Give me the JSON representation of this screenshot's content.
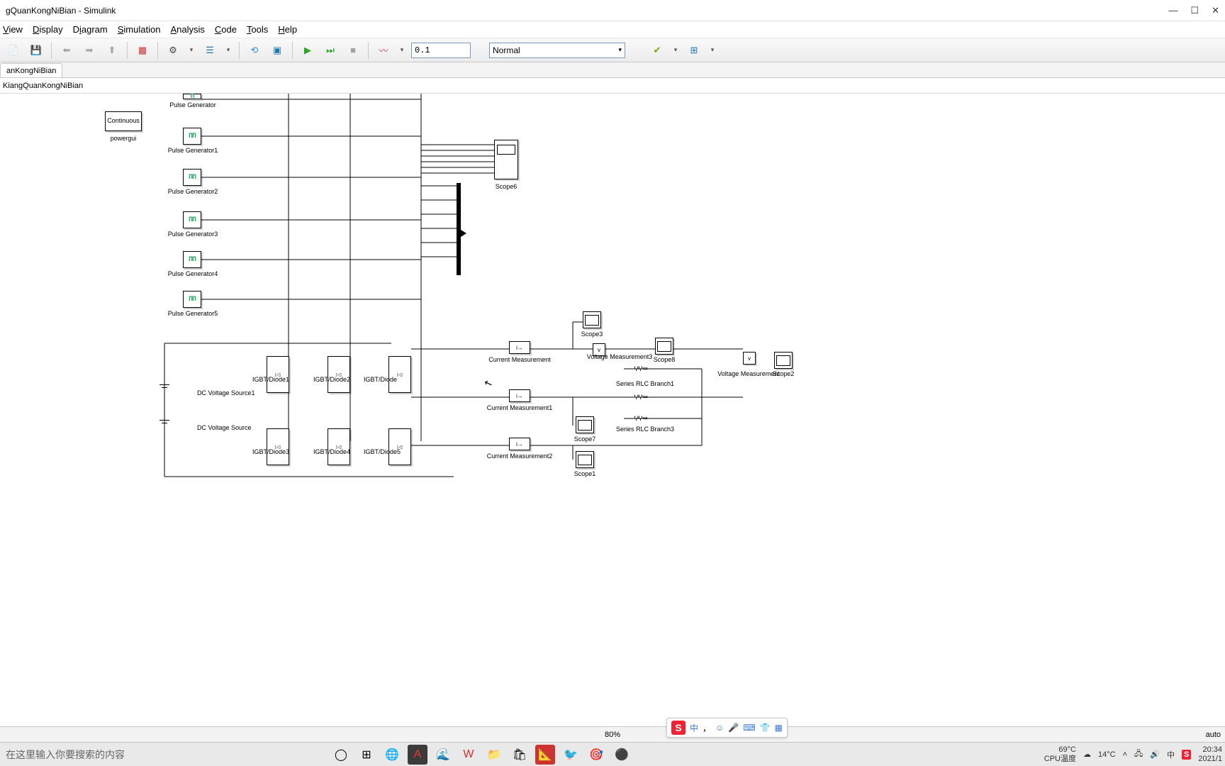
{
  "window": {
    "title": "gQuanKongNiBian - Simulink",
    "min": "—",
    "max": "☐",
    "close": "✕"
  },
  "menu": {
    "view": "View",
    "display": "Display",
    "diagram": "Diagram",
    "simulation": "Simulation",
    "analysis": "Analysis",
    "code": "Code",
    "tools": "Tools",
    "help": "Help"
  },
  "toolbar": {
    "stop_time": "0.1",
    "mode": "Normal"
  },
  "tab": {
    "name": "anKongNiBian"
  },
  "breadcrumb": {
    "path": "KiangQuanKongNiBian"
  },
  "blocks": {
    "powergui": "Continuous",
    "powergui_lbl": "powergui",
    "pg0": "Pulse\nGenerator",
    "pg1": "Pulse\nGenerator1",
    "pg2": "Pulse\nGenerator2",
    "pg3": "Pulse\nGenerator3",
    "pg4": "Pulse\nGenerator4",
    "pg5": "Pulse\nGenerator5",
    "scope6": "Scope6",
    "scope3": "Scope3",
    "scope8": "Scope8",
    "scope7": "Scope7",
    "scope1": "Scope1",
    "scope2": "Scope2",
    "dcvs1": "DC Voltage Source1",
    "dcvs": "DC Voltage Source",
    "igbt1": "IGBT/Diode1",
    "igbt2": "IGBT/Diode2",
    "igbt": "IGBT/Diode",
    "igbt3": "IGBT/Diode3",
    "igbt4": "IGBT/Diode4",
    "igbt5": "IGBT/Diode5",
    "cm": "Current Measurement",
    "cm1": "Current Measurement1",
    "cm2": "Current Measurement2",
    "vm3": "Voltage Measurement3",
    "vm": "Voltage Measurement",
    "rlc1": "Series RLC Branch1",
    "rlc3": "Series RLC Branch3"
  },
  "status": {
    "zoom": "80%",
    "rt": "auto"
  },
  "taskbar": {
    "search_placeholder": "在这里输入你要搜索的内容",
    "temp1": "69°C",
    "temp1_lbl": "CPU温度",
    "weather": "14°C",
    "time": "20:34",
    "date": "2021/1"
  },
  "ime": {
    "zh": "中"
  }
}
